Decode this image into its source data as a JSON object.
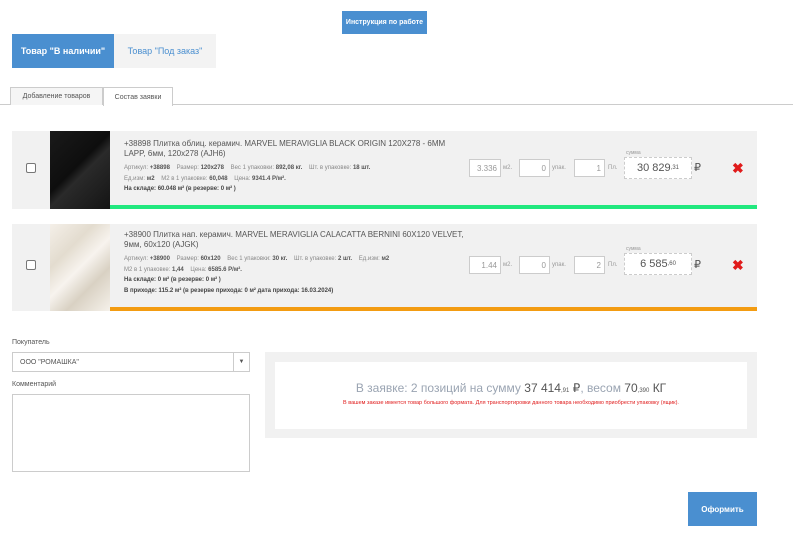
{
  "header": {
    "instruction_label": "Инструкция по работе"
  },
  "stock_tabs": {
    "in_stock": "Товар \"В наличии\"",
    "on_order": "Товар \"Под заказ\""
  },
  "subtabs": {
    "add_goods": "Добавление товаров",
    "order_content": "Состав заявки"
  },
  "items": [
    {
      "name": "+38898 Плитка облиц. керамич. MARVEL MERAVIGLIA BLACK ORIGIN 120X278 - 6MM LAPP, 6мм, 120x278 (AJH6)",
      "article_label": "Артикул:",
      "article": "+38898",
      "size_label": "Размер:",
      "size": "120x278",
      "weight_label": "Вес 1 упаковки:",
      "weight": "892,08 кг.",
      "pcs_label": "Шт. в упаковке:",
      "pcs": "18 шт.",
      "unit_label": "Ед.изм:",
      "unit": "м2",
      "m2_label": "М2 в 1 упаковке:",
      "m2": "60,048",
      "price_label": "Цена:",
      "price": "9341.4 Р/м².",
      "stock": "На складе: 60.048 м² (в резерве: 0 м² )",
      "qty_m2": "3.336",
      "unit_m2": "м2.",
      "qty_pack": "0",
      "unit_pack": "упак.",
      "qty_pl": "1",
      "unit_pl": "Пл.",
      "sum_label": "сумма",
      "sum_main": "30 829",
      "sum_cents": ",31",
      "currency": "₽",
      "bar_color": "#21e87e"
    },
    {
      "name": "+38900 Плитка нап. керамич. MARVEL MERAVIGLIA CALACATTA BERNINI 60X120 VELVET, 9мм, 60x120 (AJGK)",
      "article_label": "Артикул:",
      "article": "+38900",
      "size_label": "Размер:",
      "size": "60x120",
      "weight_label": "Вес 1 упаковки:",
      "weight": "30 кг.",
      "pcs_label": "Шт. в упаковке:",
      "pcs": "2 шт.",
      "unit_label": "Ед.изм:",
      "unit": "м2",
      "m2_label": "М2 в 1 упаковке:",
      "m2": "1,44",
      "price_label": "Цена:",
      "price": "6585.6 Р/м².",
      "stock": "На складе: 0 м² (в резерве: 0 м² )",
      "incoming": "В приходе: 115.2 м² (в резерве прихода: 0 м² дата прихода: 16.03.2024)",
      "qty_m2": "1.44",
      "unit_m2": "м2.",
      "qty_pack": "0",
      "unit_pack": "упак.",
      "qty_pl": "2",
      "unit_pl": "Пл.",
      "sum_label": "сумма",
      "sum_main": "6 585",
      "sum_cents": ",60",
      "currency": "₽",
      "bar_color": "#f39c12"
    }
  ],
  "buyer": {
    "label": "Покупатель",
    "value": "ООО \"РОМАШКА\""
  },
  "comment": {
    "label": "Комментарий",
    "placeholder": ""
  },
  "summary": {
    "prefix": "В заявке: 2 позиций на сумму",
    "sum_main": "37 414",
    "sum_cents": ",91",
    "currency": "₽",
    "weight_prefix": ", весом",
    "weight_main": "70",
    "weight_cents": ",390",
    "weight_unit": "КГ",
    "warning": "В вашем заказе имеется товар большого формата. Для транспортировки данного товара необходимо приобрести упаковку (ящик)."
  },
  "actions": {
    "submit_label": "Оформить"
  },
  "colors": {
    "accent": "#4a8fd0",
    "delete": "#e01b1b",
    "bar_in_stock": "#21e87e",
    "bar_incoming": "#f39c12"
  },
  "icons": {
    "delete": "close-icon",
    "select_arrow": "chevron-down-icon"
  }
}
